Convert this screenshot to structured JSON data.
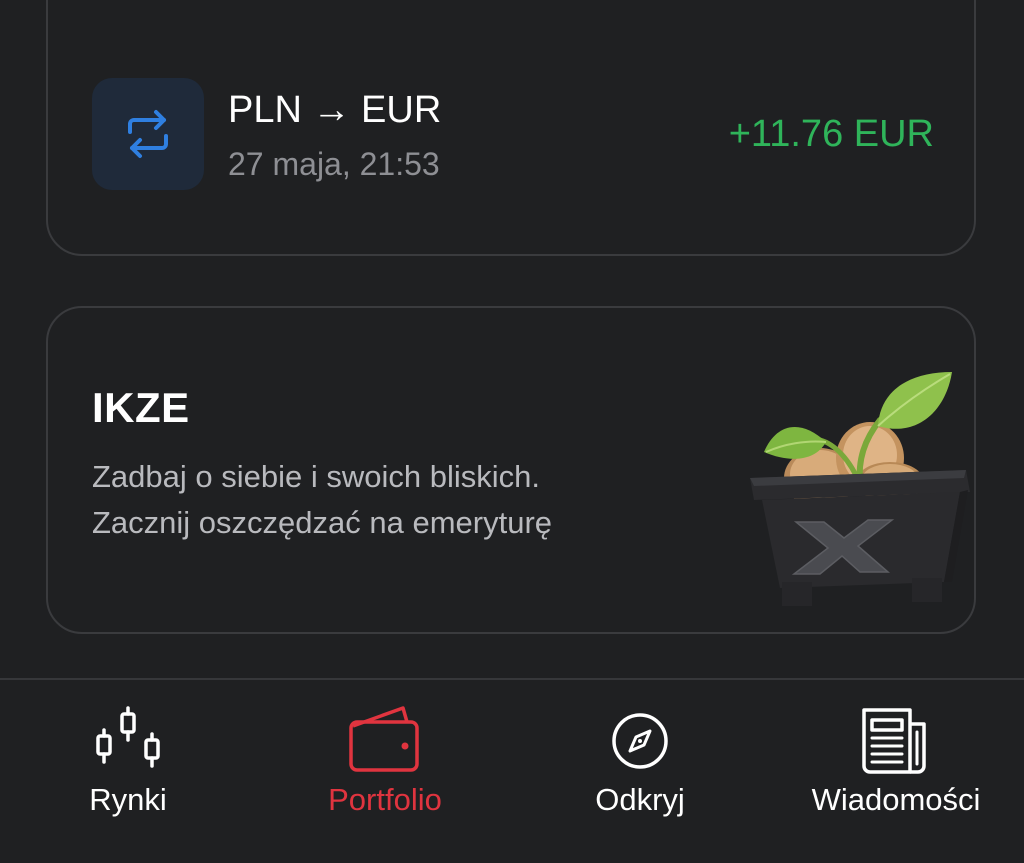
{
  "transaction": {
    "title": "PLN → EUR",
    "date": "27 maja, 21:53",
    "amount": "+11.76 EUR",
    "amount_color": "#2fb45a",
    "icon": "exchange-arrows-icon"
  },
  "promo": {
    "title": "IKZE",
    "line1": "Zadbaj o siebie i swoich bliskich.",
    "line2": "Zacznij oszczędzać na emeryturę",
    "image": "plant-pot-coins-illustration"
  },
  "nav": {
    "active": "Portfolio",
    "active_color": "#e0343f",
    "items": [
      {
        "label": "Rynki",
        "icon": "candlestick-chart-icon"
      },
      {
        "label": "Portfolio",
        "icon": "wallet-icon"
      },
      {
        "label": "Odkryj",
        "icon": "compass-icon"
      },
      {
        "label": "Wiadomości",
        "icon": "newspaper-icon"
      }
    ]
  }
}
